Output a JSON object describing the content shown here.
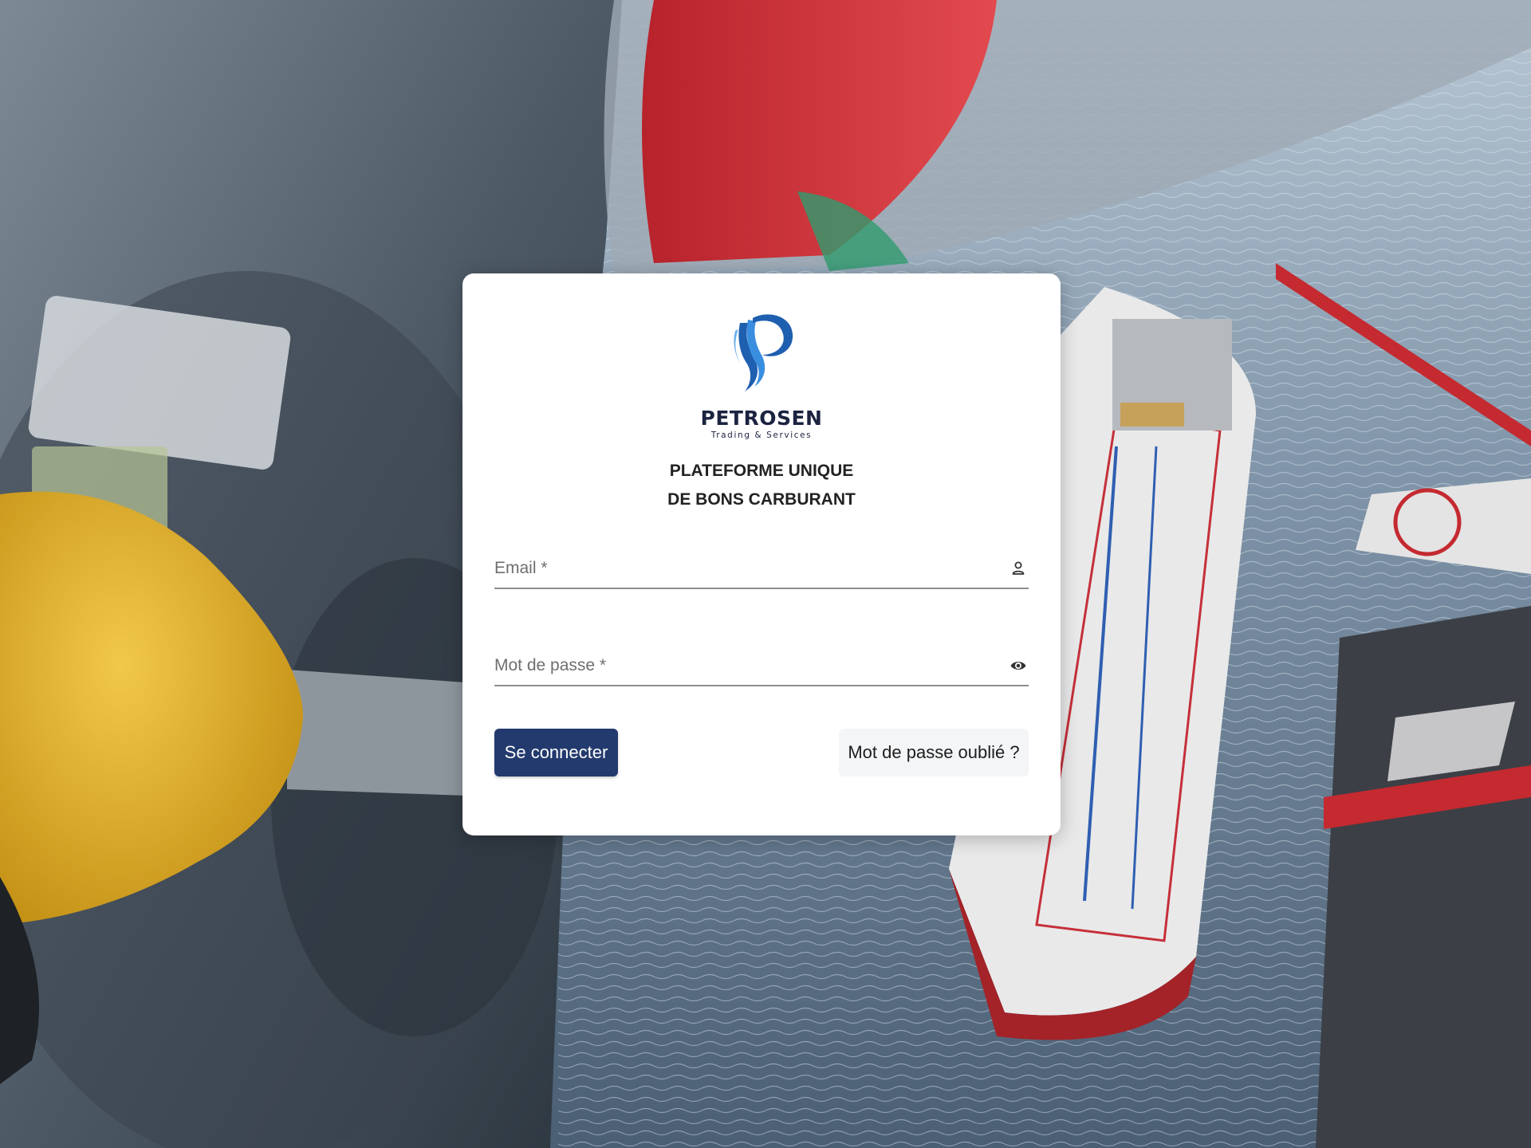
{
  "brand": {
    "name": "PETROSEN",
    "tagline": "Trading & Services"
  },
  "title": {
    "line1": "PLATEFORME UNIQUE",
    "line2": "DE BONS CARBURANT"
  },
  "form": {
    "email_placeholder": "Email *",
    "email_icon": "person-icon",
    "password_placeholder": "Mot de passe *",
    "password_icon": "eye-icon",
    "login_button": "Se connecter",
    "forgot_button": "Mot de passe oublié ?"
  },
  "colors": {
    "primary": "#233a6e",
    "logo_blue": "#2a7fd4"
  }
}
